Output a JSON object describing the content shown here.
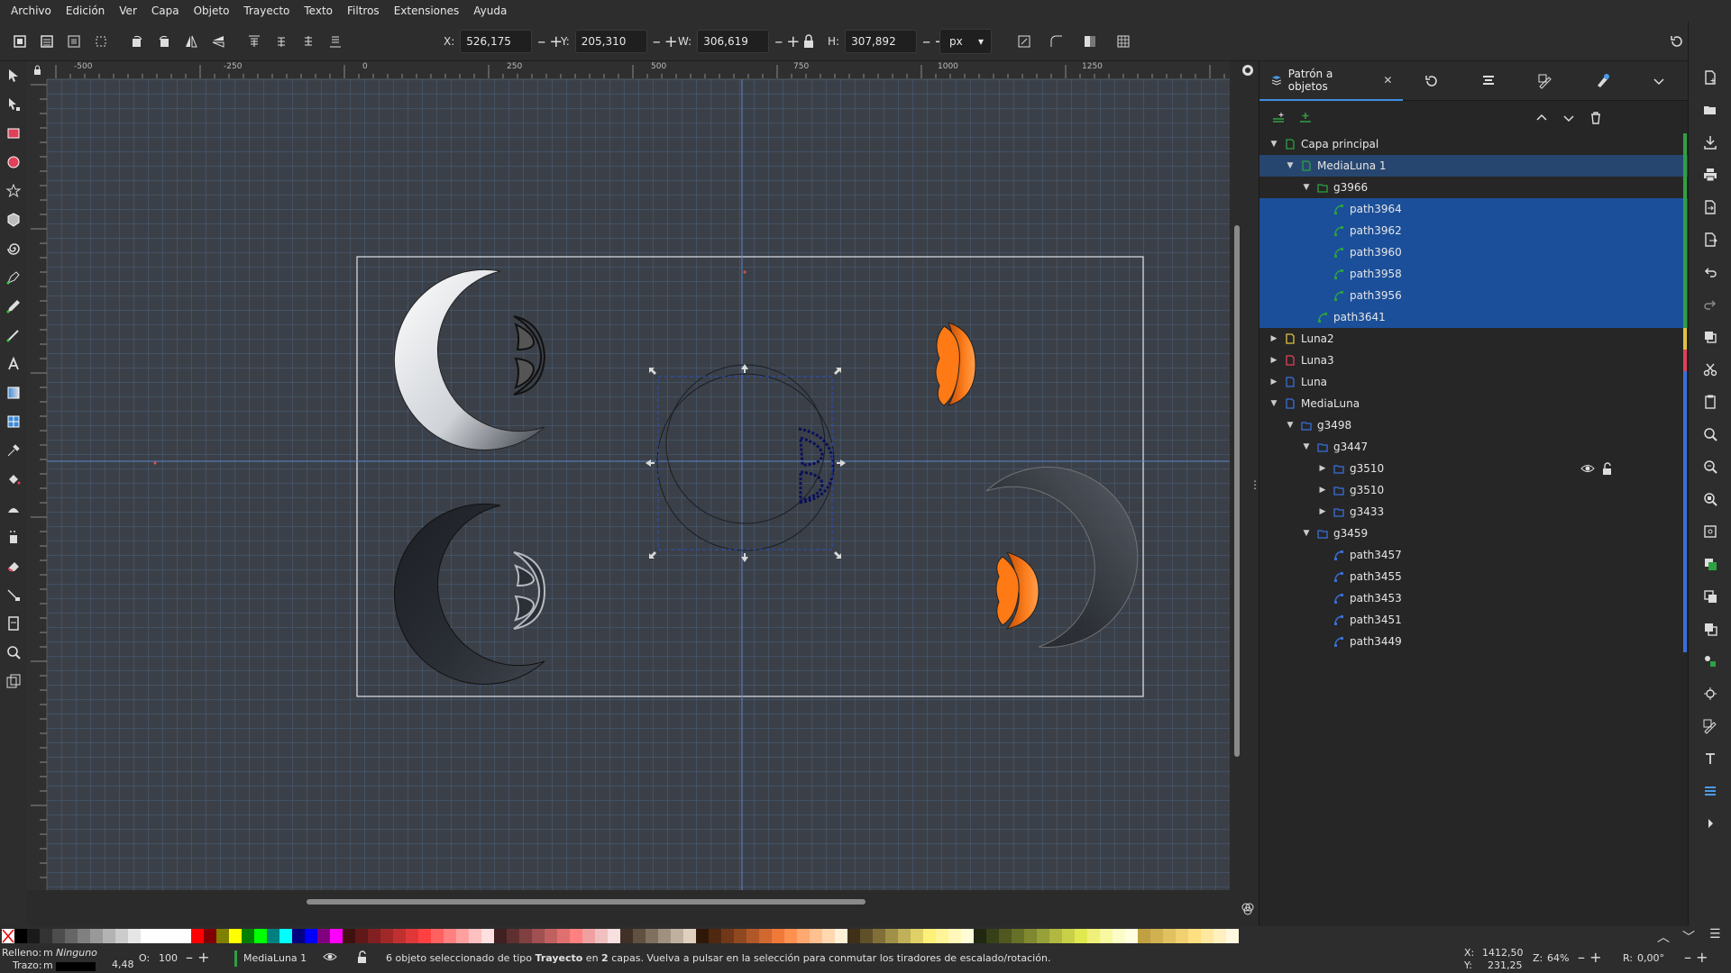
{
  "menu": [
    "Archivo",
    "Edición",
    "Ver",
    "Capa",
    "Objeto",
    "Trayecto",
    "Texto",
    "Filtros",
    "Extensiones",
    "Ayuda"
  ],
  "toolbar": {
    "x_label": "X:",
    "x_value": "526,175",
    "y_label": "Y:",
    "y_value": "205,310",
    "w_label": "W:",
    "w_value": "306,619",
    "h_label": "H:",
    "h_value": "307,892",
    "unit": "px"
  },
  "ruler": {
    "h_labels": [
      "-500",
      "-250",
      "0",
      "250",
      "500",
      "750",
      "1000",
      "1250"
    ]
  },
  "dock": {
    "active_tab": "Patrón a objetos",
    "tree": [
      {
        "label": "Capa principal",
        "depth": 0,
        "expanded": true,
        "type": "layer",
        "color": "#2ea043",
        "state": ""
      },
      {
        "label": "MediaLuna 1",
        "depth": 1,
        "expanded": true,
        "type": "layer",
        "color": "#2ea043",
        "state": "selhead"
      },
      {
        "label": "g3966",
        "depth": 2,
        "expanded": true,
        "type": "group",
        "color": "#2ea043",
        "state": ""
      },
      {
        "label": "path3964",
        "depth": 3,
        "type": "path",
        "color": "#2ea043",
        "state": "sel"
      },
      {
        "label": "path3962",
        "depth": 3,
        "type": "path",
        "color": "#2ea043",
        "state": "sel"
      },
      {
        "label": "path3960",
        "depth": 3,
        "type": "path",
        "color": "#2ea043",
        "state": "sel"
      },
      {
        "label": "path3958",
        "depth": 3,
        "type": "path",
        "color": "#2ea043",
        "state": "sel"
      },
      {
        "label": "path3956",
        "depth": 3,
        "type": "path",
        "color": "#2ea043",
        "state": "sel"
      },
      {
        "label": "path3641",
        "depth": 2,
        "type": "path",
        "color": "#2ea043",
        "state": "sel"
      },
      {
        "label": "Luna2",
        "depth": 0,
        "expanded": false,
        "type": "layer",
        "color": "#e0c040",
        "state": ""
      },
      {
        "label": "Luna3",
        "depth": 0,
        "expanded": false,
        "type": "layer",
        "color": "#e0405a",
        "state": ""
      },
      {
        "label": "Luna",
        "depth": 0,
        "expanded": false,
        "type": "layer",
        "color": "#3a6fd8",
        "state": ""
      },
      {
        "label": "MediaLuna",
        "depth": 0,
        "expanded": true,
        "type": "layer",
        "color": "#3a6fd8",
        "state": ""
      },
      {
        "label": "g3498",
        "depth": 1,
        "expanded": true,
        "type": "group",
        "color": "#3a6fd8",
        "state": ""
      },
      {
        "label": "g3447",
        "depth": 2,
        "expanded": true,
        "type": "group",
        "color": "#3a6fd8",
        "state": ""
      },
      {
        "label": "g3510",
        "depth": 3,
        "expanded": false,
        "type": "group",
        "color": "#3a6fd8",
        "state": "hover"
      },
      {
        "label": "g3510",
        "depth": 3,
        "expanded": false,
        "type": "group",
        "color": "#3a6fd8",
        "state": ""
      },
      {
        "label": "g3433",
        "depth": 3,
        "expanded": false,
        "type": "group",
        "color": "#3a6fd8",
        "state": ""
      },
      {
        "label": "g3459",
        "depth": 2,
        "expanded": true,
        "type": "group",
        "color": "#3a6fd8",
        "state": ""
      },
      {
        "label": "path3457",
        "depth": 3,
        "type": "path",
        "color": "#3a6fd8",
        "state": ""
      },
      {
        "label": "path3455",
        "depth": 3,
        "type": "path",
        "color": "#3a6fd8",
        "state": ""
      },
      {
        "label": "path3453",
        "depth": 3,
        "type": "path",
        "color": "#3a6fd8",
        "state": ""
      },
      {
        "label": "path3451",
        "depth": 3,
        "type": "path",
        "color": "#3a6fd8",
        "state": ""
      },
      {
        "label": "path3449",
        "depth": 3,
        "type": "path",
        "color": "#3a6fd8",
        "state": ""
      }
    ]
  },
  "palette": [
    "#000000",
    "#1a1a1a",
    "#333333",
    "#4d4d4d",
    "#666666",
    "#808080",
    "#999999",
    "#b3b3b3",
    "#cccccc",
    "#e6e6e6",
    "#ffffff",
    "#ffffff",
    "#ffffff",
    "#ffffff",
    "#ff0000",
    "#800000",
    "#808000",
    "#ffff00",
    "#008000",
    "#00ff00",
    "#008080",
    "#00ffff",
    "#000080",
    "#0000ff",
    "#800080",
    "#ff00ff",
    "#401010",
    "#601818",
    "#802020",
    "#a02828",
    "#c03030",
    "#e03838",
    "#ff4040",
    "#ff6060",
    "#ff8080",
    "#ffa0a0",
    "#ffc0c0",
    "#ffe0e0",
    "#402020",
    "#603030",
    "#804040",
    "#a05050",
    "#c06060",
    "#e07070",
    "#ff8080",
    "#f0a0a0",
    "#f0c0c0",
    "#f8e0e0",
    "#403028",
    "#605040",
    "#807060",
    "#a09080",
    "#c0b0a0",
    "#e0d0c0",
    "#301808",
    "#502810",
    "#703818",
    "#904820",
    "#b05828",
    "#d06830",
    "#f07838",
    "#ff9050",
    "#ffa870",
    "#ffc090",
    "#ffd8b0",
    "#fff0d8",
    "#403018",
    "#605028",
    "#807038",
    "#a09048",
    "#c0b058",
    "#e0d068",
    "#fff078",
    "#fff498",
    "#fff8b8",
    "#fffcd8",
    "#202810",
    "#384018",
    "#505820",
    "#687028",
    "#808830",
    "#98a038",
    "#b0b840",
    "#c8d048",
    "#e0e850",
    "#f0f078",
    "#f8f8a0",
    "#fcfcc8",
    "#ffffe0",
    "#c0a040",
    "#d0b050",
    "#e0c060",
    "#f0d070",
    "#ffe080",
    "#ffe8a0",
    "#fff0c0",
    "#fff8e0"
  ],
  "status": {
    "fill_label": "Relleno:",
    "fill_m": "m",
    "fill_value": "Ninguno",
    "stroke_label": "Trazo:",
    "stroke_m": "m",
    "stroke_width": "4,48",
    "opacity_label": "O:",
    "opacity_value": "100",
    "layer_name": "MediaLuna 1",
    "message_pre": "6 objeto seleccionado de tipo ",
    "message_b1": "Trayecto",
    "message_mid": " en ",
    "message_b2": "2",
    "message_post": " capas. Vuelva a pulsar en la selección para conmutar los tiradores de escalado/rotación.",
    "cursor_x_label": "X:",
    "cursor_x": "1412,50",
    "cursor_y_label": "Y:",
    "cursor_y": "231,25",
    "zoom_label": "Z:",
    "zoom": "64%",
    "rotation_label": "R:",
    "rotation": "0,00°"
  }
}
